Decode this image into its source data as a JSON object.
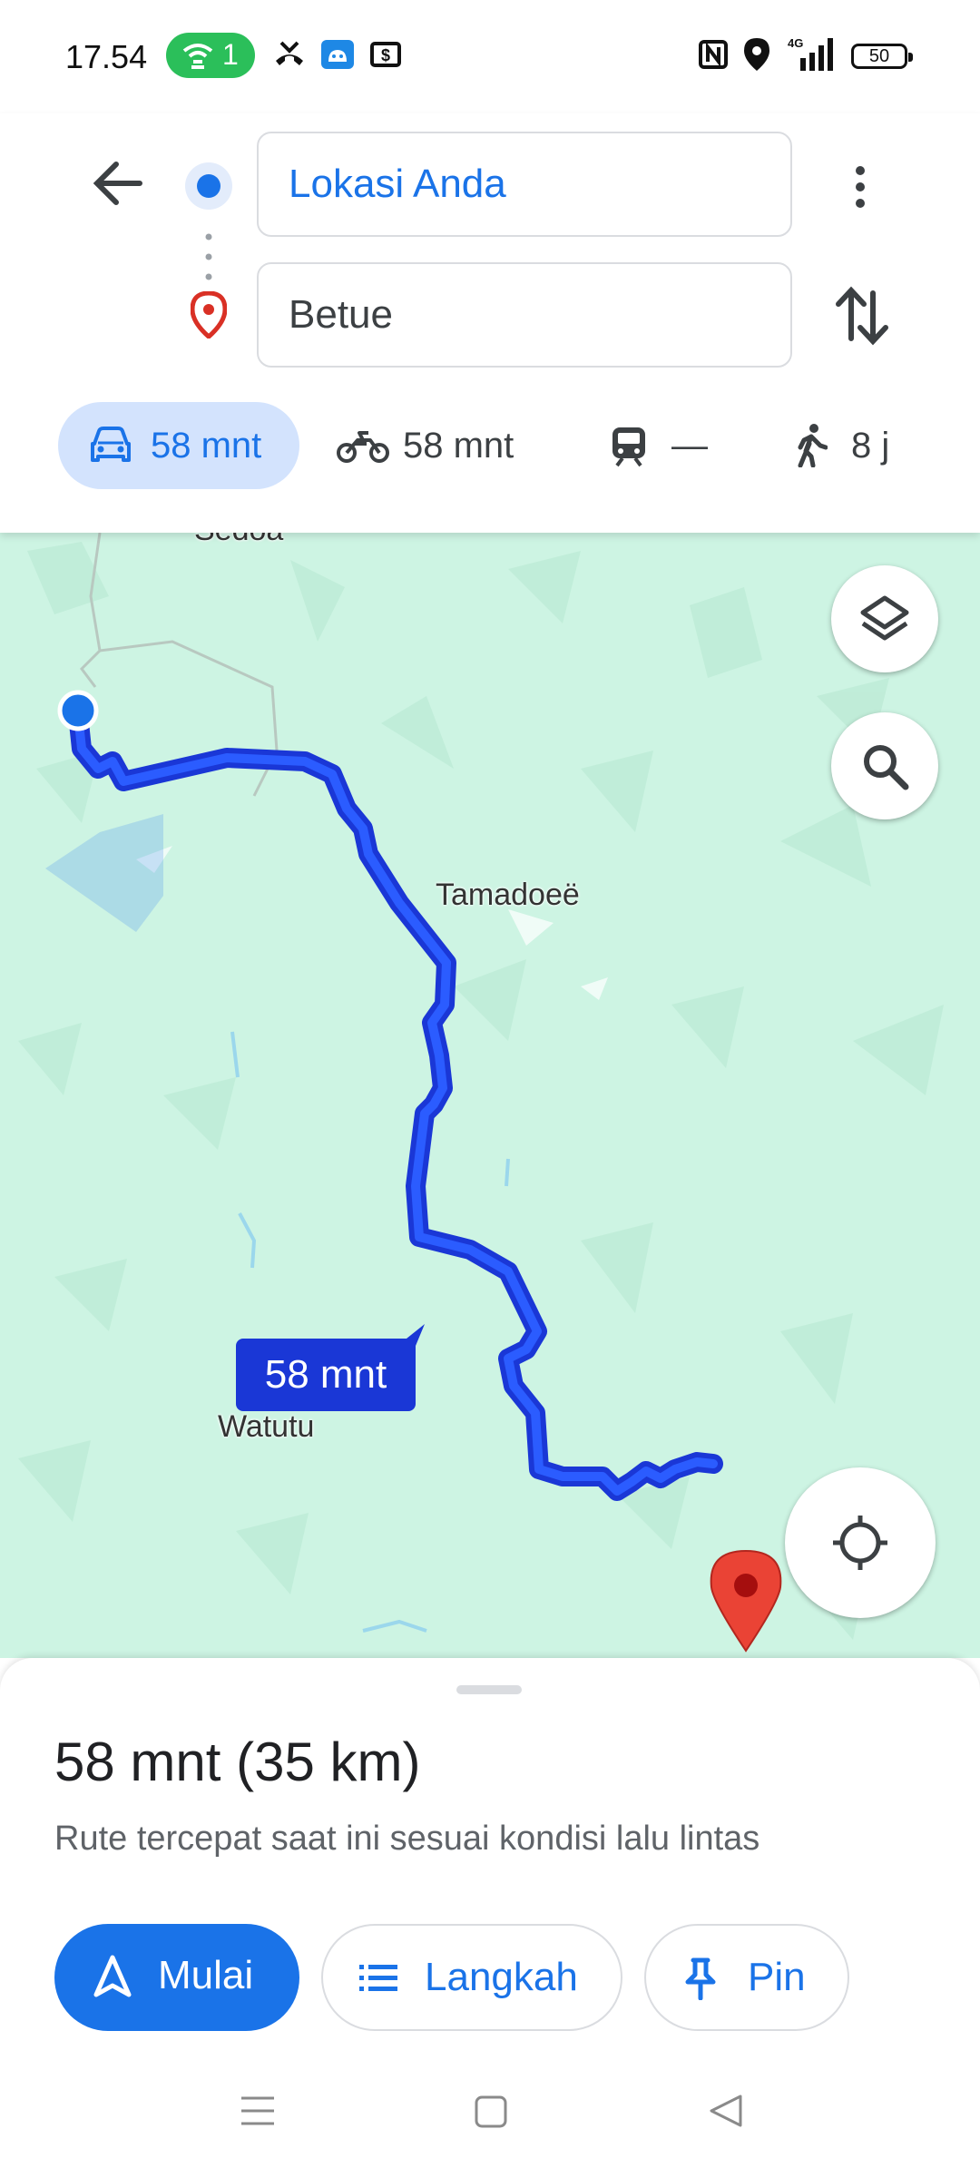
{
  "status_bar": {
    "time": "17.54",
    "hotspot_count": "1",
    "network": "4G",
    "battery": "50"
  },
  "directions": {
    "origin": "Lokasi Anda",
    "destination": "Betue"
  },
  "modes": [
    {
      "icon": "car-icon",
      "label": "58 mnt"
    },
    {
      "icon": "motorcycle-icon",
      "label": "58 mnt"
    },
    {
      "icon": "transit-icon",
      "label": "—"
    },
    {
      "icon": "walk-icon",
      "label": "8 j"
    }
  ],
  "map": {
    "places": [
      "Sedoa",
      "Tamadoeë",
      "Watutu"
    ],
    "route_badge": "58 mnt",
    "colors": {
      "route": "#1a37d6",
      "land": "#cdf4e3",
      "destination": "#ea4335"
    }
  },
  "sheet": {
    "title": "58 mnt (35 km)",
    "subtitle": "Rute tercepat saat ini sesuai kondisi lalu lintas",
    "start_label": "Mulai",
    "steps_label": "Langkah",
    "pin_label": "Pin"
  }
}
